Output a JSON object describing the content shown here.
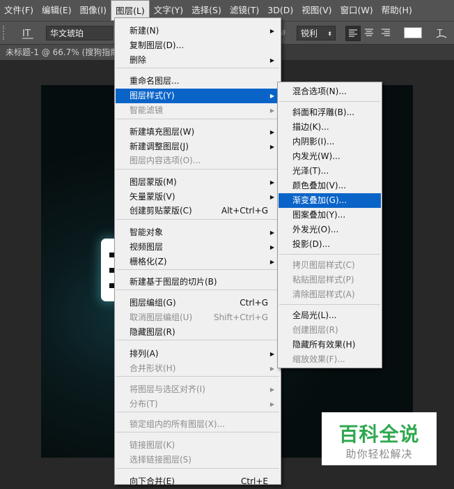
{
  "menubar": {
    "items": [
      "文件(F)",
      "编辑(E)",
      "图像(I)",
      "图层(L)",
      "文字(Y)",
      "选择(S)",
      "滤镜(T)",
      "3D(D)",
      "视图(V)",
      "窗口(W)",
      "帮助(H)"
    ]
  },
  "options": {
    "tool_icon": "text-orientation-icon",
    "font_family": "华文琥珀",
    "aa_label": "a",
    "aa_mode": "锐利",
    "align_icons": [
      "align-left-icon",
      "align-center-icon",
      "align-right-icon"
    ],
    "color_swatch": "#ffffff",
    "warp_icon": "warp-text-icon"
  },
  "tab": {
    "title": "未标题-1 @ 66.7% (搜狗指南"
  },
  "layer_menu": {
    "items": [
      {
        "label": "新建(N)",
        "shortcut": "",
        "submenu": true,
        "disabled": false
      },
      {
        "label": "复制图层(D)...",
        "shortcut": "",
        "submenu": false,
        "disabled": false
      },
      {
        "label": "删除",
        "shortcut": "",
        "submenu": true,
        "disabled": false
      },
      {
        "label": "重命名图层...",
        "shortcut": "",
        "submenu": false,
        "disabled": false
      },
      {
        "label": "图层样式(Y)",
        "shortcut": "",
        "submenu": true,
        "disabled": false,
        "highlighted": true
      },
      {
        "label": "智能滤镜",
        "shortcut": "",
        "submenu": true,
        "disabled": true
      },
      {
        "label": "新建填充图层(W)",
        "shortcut": "",
        "submenu": true,
        "disabled": false
      },
      {
        "label": "新建调整图层(J)",
        "shortcut": "",
        "submenu": true,
        "disabled": false
      },
      {
        "label": "图层内容选项(O)...",
        "shortcut": "",
        "submenu": false,
        "disabled": true
      },
      {
        "label": "图层蒙版(M)",
        "shortcut": "",
        "submenu": true,
        "disabled": false
      },
      {
        "label": "矢量蒙版(V)",
        "shortcut": "",
        "submenu": true,
        "disabled": false
      },
      {
        "label": "创建剪贴蒙版(C)",
        "shortcut": "Alt+Ctrl+G",
        "submenu": false,
        "disabled": false
      },
      {
        "label": "智能对象",
        "shortcut": "",
        "submenu": true,
        "disabled": false
      },
      {
        "label": "视频图层",
        "shortcut": "",
        "submenu": true,
        "disabled": false
      },
      {
        "label": "栅格化(Z)",
        "shortcut": "",
        "submenu": true,
        "disabled": false
      },
      {
        "label": "新建基于图层的切片(B)",
        "shortcut": "",
        "submenu": false,
        "disabled": false
      },
      {
        "label": "图层编组(G)",
        "shortcut": "Ctrl+G",
        "submenu": false,
        "disabled": false
      },
      {
        "label": "取消图层编组(U)",
        "shortcut": "Shift+Ctrl+G",
        "submenu": false,
        "disabled": true
      },
      {
        "label": "隐藏图层(R)",
        "shortcut": "",
        "submenu": false,
        "disabled": false
      },
      {
        "label": "排列(A)",
        "shortcut": "",
        "submenu": true,
        "disabled": false
      },
      {
        "label": "合并形状(H)",
        "shortcut": "",
        "submenu": true,
        "disabled": true
      },
      {
        "label": "将图层与选区对齐(I)",
        "shortcut": "",
        "submenu": true,
        "disabled": true
      },
      {
        "label": "分布(T)",
        "shortcut": "",
        "submenu": true,
        "disabled": true
      },
      {
        "label": "锁定组内的所有图层(X)...",
        "shortcut": "",
        "submenu": false,
        "disabled": true
      },
      {
        "label": "链接图层(K)",
        "shortcut": "",
        "submenu": false,
        "disabled": true
      },
      {
        "label": "选择链接图层(S)",
        "shortcut": "",
        "submenu": false,
        "disabled": true
      },
      {
        "label": "向下合并(E)",
        "shortcut": "Ctrl+E",
        "submenu": false,
        "disabled": false
      }
    ]
  },
  "style_submenu": {
    "items": [
      {
        "label": "混合选项(N)...",
        "disabled": false
      },
      {
        "label": "斜面和浮雕(B)...",
        "disabled": false
      },
      {
        "label": "描边(K)...",
        "disabled": false
      },
      {
        "label": "内阴影(I)...",
        "disabled": false
      },
      {
        "label": "内发光(W)...",
        "disabled": false
      },
      {
        "label": "光泽(T)...",
        "disabled": false
      },
      {
        "label": "颜色叠加(V)...",
        "disabled": false
      },
      {
        "label": "渐变叠加(G)...",
        "disabled": false,
        "highlighted": true
      },
      {
        "label": "图案叠加(Y)...",
        "disabled": false
      },
      {
        "label": "外发光(O)...",
        "disabled": false
      },
      {
        "label": "投影(D)...",
        "disabled": false
      },
      {
        "label": "拷贝图层样式(C)",
        "disabled": true
      },
      {
        "label": "粘贴图层样式(P)",
        "disabled": true
      },
      {
        "label": "清除图层样式(A)",
        "disabled": true
      },
      {
        "label": "全局光(L)...",
        "disabled": false
      },
      {
        "label": "创建图层(R)",
        "disabled": true
      },
      {
        "label": "隐藏所有效果(H)",
        "disabled": false
      },
      {
        "label": "缩放效果(F)...",
        "disabled": true
      }
    ]
  },
  "watermark": {
    "title": "百科全说",
    "subtitle": "助你轻松解决"
  },
  "colors": {
    "highlight": "#0a64c8",
    "menu_bg": "#f0f0f0",
    "watermark_title": "#2fa84f",
    "canvas_glow": "#5ac8d2"
  }
}
